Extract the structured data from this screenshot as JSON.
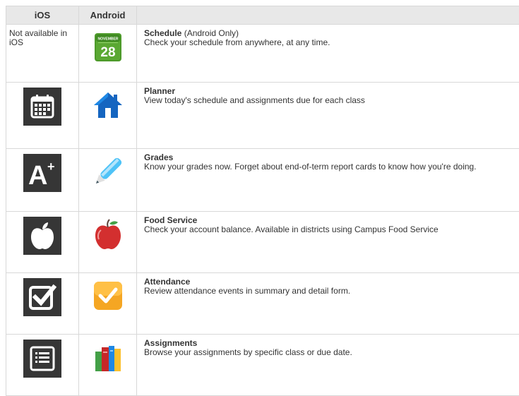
{
  "headers": {
    "ios": "iOS",
    "android": "Android",
    "description": ""
  },
  "rows": [
    {
      "name": "Schedule",
      "name_suffix": " (Android Only)",
      "description": "Check your schedule from anywhere, at any time.",
      "ios_text": "Not available in iOS",
      "calendar_month": "NOVEMBER",
      "calendar_day": "28"
    },
    {
      "name": "Planner",
      "name_suffix": "",
      "description": "View today's schedule and assignments due for each class",
      "ios_text": ""
    },
    {
      "name": "Grades",
      "name_suffix": "",
      "description": "Know your grades now. Forget about end-of-term report cards to know how you're doing.",
      "ios_text": "",
      "ios_glyph": "A",
      "ios_glyph_sup": "+"
    },
    {
      "name": "Food Service",
      "name_suffix": "",
      "description": "Check your account balance. Available in districts using Campus Food Service",
      "ios_text": ""
    },
    {
      "name": "Attendance",
      "name_suffix": "",
      "description": "Review attendance events in summary and detail form.",
      "ios_text": ""
    },
    {
      "name": "Assignments",
      "name_suffix": "",
      "description": "Browse your assignments by specific class or due date.",
      "ios_text": ""
    }
  ],
  "colors": {
    "header_bg": "#e8e8e8",
    "border": "#d8d8d8",
    "ios_tile": "#363636",
    "android_calendar_green": "#5aa832",
    "android_house_blue": "#1565c0",
    "android_apple_red": "#d32f2f",
    "android_check_orange": "#f5a623"
  }
}
